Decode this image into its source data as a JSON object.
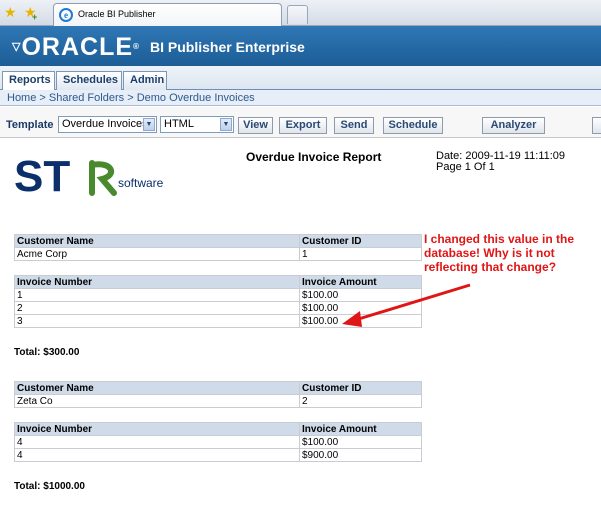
{
  "browser": {
    "tab_title": "Oracle BI Publisher"
  },
  "header": {
    "logo_text": "ORACLE",
    "product": "BI Publisher Enterprise"
  },
  "menu_tabs": [
    {
      "label": "Reports"
    },
    {
      "label": "Schedules"
    },
    {
      "label": "Admin"
    }
  ],
  "breadcrumb": {
    "home": "Home",
    "folder": "Shared Folders",
    "report": "Demo Overdue Invoices",
    "separator": ">"
  },
  "toolbar": {
    "template_label": "Template",
    "template_value": "Overdue Invoices",
    "format_value": "HTML",
    "view": "View",
    "export": "Export",
    "send": "Send",
    "schedule": "Schedule",
    "analyzer": "Analyzer"
  },
  "report": {
    "logo_letters": "ST",
    "logo_sub": "software",
    "title": "Overdue Invoice Report",
    "date": "Date: 2009-11-19 11:11:09",
    "page": "Page 1 Of 1",
    "labels": {
      "customer_name": "Customer Name",
      "customer_id": "Customer ID",
      "invoice_number": "Invoice Number",
      "invoice_amount": "Invoice Amount"
    },
    "customers": [
      {
        "name": "Acme Corp",
        "id": "1",
        "invoices": [
          {
            "number": "1",
            "amount": "$100.00"
          },
          {
            "number": "2",
            "amount": "$100.00"
          },
          {
            "number": "3",
            "amount": "$100.00"
          }
        ],
        "total": "Total: $300.00"
      },
      {
        "name": "Zeta Co",
        "id": "2",
        "invoices": [
          {
            "number": "4",
            "amount": "$100.00"
          },
          {
            "number": "4",
            "amount": "$900.00"
          }
        ],
        "total": "Total: $1000.00"
      }
    ]
  },
  "annotation": {
    "line1": "I changed this value in the",
    "line2": "database!  Why is it not",
    "line3": "reflecting that change?",
    "color": "#e01515"
  },
  "colors": {
    "brand_blue": "#1c5d96",
    "table_header": "#cfdbe8",
    "str_blue": "#0a2f6b",
    "str_green": "#4a8a2e"
  }
}
